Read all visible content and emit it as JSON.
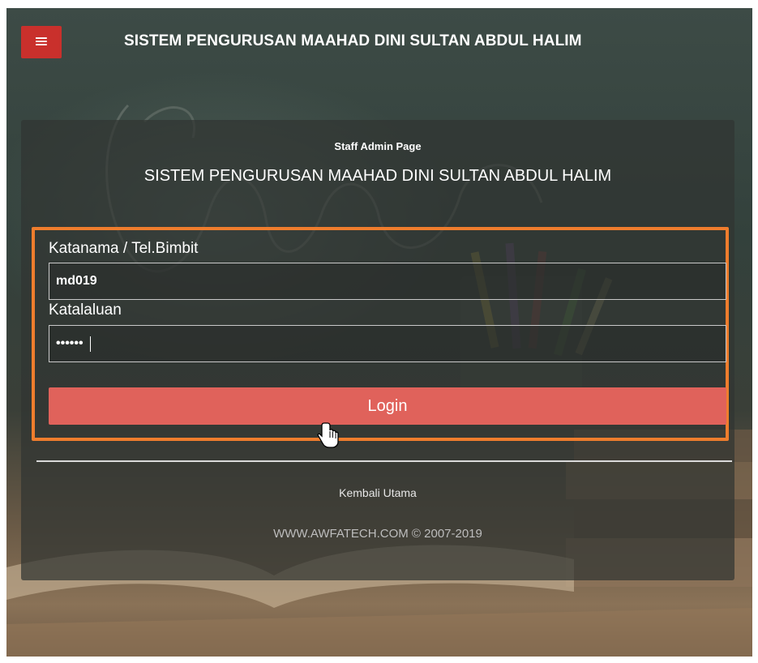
{
  "header": {
    "menu_icon": "hamburger-menu-icon",
    "menu_glyph": "≡",
    "title": "SISTEM PENGURUSAN MAAHAD DINI SULTAN ABDUL HALIM"
  },
  "login": {
    "subtitle": "Staff Admin Page",
    "title": "SISTEM PENGURUSAN MAAHAD DINI SULTAN ABDUL HALIM",
    "username_label": "Katanama / Tel.Bimbit",
    "username_value": "md019",
    "password_label": "Katalaluan",
    "password_value": "••••••",
    "login_button": "Login"
  },
  "footer": {
    "back_link": "Kembali Utama",
    "copyright": "WWW.AWFATECH.COM © 2007-2019"
  },
  "colors": {
    "menu_button": "#c9302c",
    "login_button": "#e0625b",
    "highlight_border": "#ef7d2d"
  },
  "cursor_icon": "hand-pointer-cursor-icon"
}
